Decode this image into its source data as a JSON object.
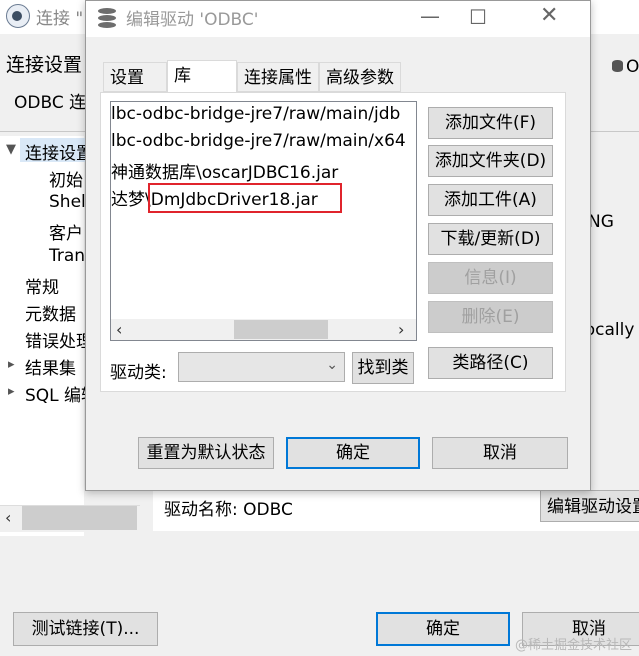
{
  "background_window": {
    "title": "连接 \"",
    "heading": "连接设置",
    "subheading": "ODBC 连",
    "tree": {
      "items": [
        {
          "label": "连接设置",
          "expanded": true
        },
        {
          "label": "初始"
        },
        {
          "label": "Shel"
        },
        {
          "label": "客户"
        },
        {
          "label": "Tran"
        },
        {
          "label": "常规"
        },
        {
          "label": "元数据"
        },
        {
          "label": "错误处理"
        },
        {
          "label": "结果集",
          "expandable": true
        },
        {
          "label": "SQL 编辑",
          "expandable": true
        }
      ]
    },
    "right_fragments": {
      "db_label": "O",
      "ng": "NG",
      "locally": "locally"
    },
    "driver_name_label": "驱动名称:",
    "driver_name_value": "ODBC",
    "edit_driver_button": "编辑驱动设置",
    "test_button": "测试链接(T)...",
    "ok_button": "确定",
    "cancel_button": "取消"
  },
  "dialog": {
    "title": "编辑驱动 'ODBC'",
    "tabs": [
      {
        "label": "设置"
      },
      {
        "label": "库",
        "active": true
      },
      {
        "label": "连接属性"
      },
      {
        "label": "高级参数"
      }
    ],
    "libraries": [
      "lbc-odbc-bridge-jre7/raw/main/jdb",
      "lbc-odbc-bridge-jre7/raw/main/x64",
      "神通数据库\\oscarJDBC16.jar",
      "达梦\\DmJdbcDriver18.jar"
    ],
    "side_buttons": [
      {
        "label": "添加文件(F)",
        "enabled": true
      },
      {
        "label": "添加文件夹(D)",
        "enabled": true
      },
      {
        "label": "添加工件(A)",
        "enabled": true
      },
      {
        "label": "下载/更新(D)",
        "enabled": true
      },
      {
        "label": "信息(I)",
        "enabled": false
      },
      {
        "label": "删除(E)",
        "enabled": false
      },
      {
        "label": "类路径(C)",
        "enabled": true
      }
    ],
    "driver_class_label": "驱动类:",
    "driver_class_value": "",
    "find_class_button": "找到类",
    "reset_button": "重置为默认状态",
    "ok_button": "确定",
    "cancel_button": "取消"
  },
  "watermark": "@稀土掘金技术社区",
  "colors": {
    "accent": "#0078d7",
    "highlight": "#e0242c"
  }
}
